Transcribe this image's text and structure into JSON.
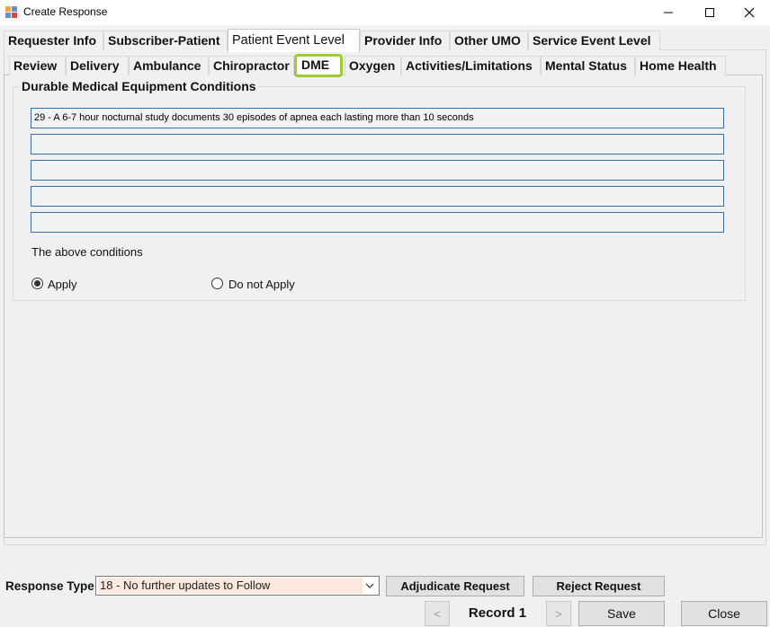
{
  "window": {
    "title": "Create Response",
    "minimize_icon": "minimize-icon",
    "maximize_icon": "maximize-icon",
    "close_icon": "close-icon"
  },
  "tabs_top": [
    {
      "label": "Requester Info"
    },
    {
      "label": "Subscriber-Patient"
    },
    {
      "label": "Patient Event Level",
      "selected": true
    },
    {
      "label": "Provider Info"
    },
    {
      "label": "Other UMO"
    },
    {
      "label": "Service Event Level"
    }
  ],
  "tabs_sub": [
    {
      "label": "Review"
    },
    {
      "label": "Delivery"
    },
    {
      "label": "Ambulance"
    },
    {
      "label": "Chiropractor"
    },
    {
      "label": "DME",
      "selected": true
    },
    {
      "label": "Oxygen"
    },
    {
      "label": "Activities/Limitations"
    },
    {
      "label": "Mental Status"
    },
    {
      "label": "Home Health"
    }
  ],
  "dme": {
    "group_title": "Durable Medical Equipment Conditions",
    "conditions": [
      "29 - A 6-7 hour nocturnal study documents 30 episodes of apnea each lasting more than 10 seconds",
      "",
      "",
      "",
      ""
    ],
    "apply_caption": "The above conditions",
    "options": {
      "apply": {
        "label": "Apply",
        "checked": true
      },
      "do_not_apply": {
        "label": "Do not Apply",
        "checked": false
      }
    }
  },
  "footer": {
    "response_type_label": "Response Type",
    "response_type_value": "18 - No further updates to Follow",
    "adjudicate_label": "Adjudicate Request",
    "reject_label": "Reject Request",
    "prev_label": "<",
    "record_label": "Record 1",
    "next_label": ">",
    "save_label": "Save",
    "close_label": "Close"
  },
  "colors": {
    "selected_tab_outline": "#9acd32",
    "field_border": "#3a6fa5",
    "select_fill": "#fbe9dd"
  }
}
